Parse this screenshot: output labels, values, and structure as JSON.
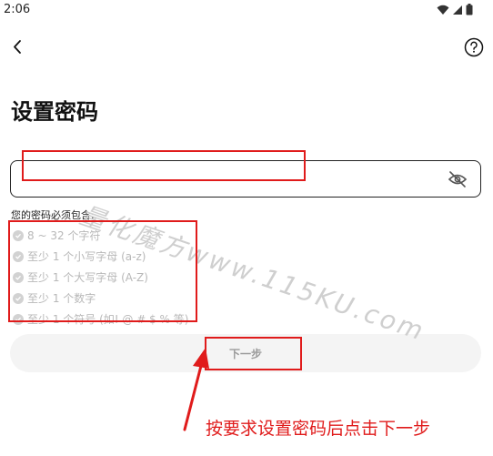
{
  "status_bar": {
    "time": "2:06"
  },
  "page": {
    "title": "设置密码"
  },
  "password_field": {
    "value": "",
    "placeholder": ""
  },
  "requirements": {
    "heading": "您的密码必须包含:",
    "items": [
      "8 ~ 32 个字符",
      "至少 1 个小写字母 (a-z)",
      "至少 1 个大写字母 (A-Z)",
      "至少 1 个数字",
      "至少 1 个符号 (如! @ # $ % 等)"
    ]
  },
  "next_button": {
    "label": "下一步"
  },
  "annotation": {
    "text": "按要求设置密码后点击下一步"
  },
  "watermark": {
    "text": "量化魔方www.115KU.com"
  },
  "colors": {
    "annotation": "#e01b1b",
    "rule_text": "#b8b8b8",
    "button_bg": "#f4f4f4"
  },
  "icons": [
    "back-arrow-icon",
    "help-icon",
    "eye-off-icon",
    "check-circle-icon",
    "wifi-icon",
    "signal-icon",
    "battery-icon"
  ]
}
